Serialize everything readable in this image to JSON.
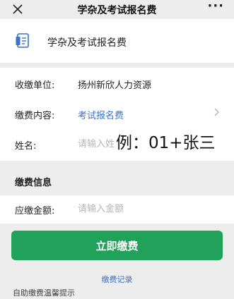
{
  "nav": {
    "title": "学杂及考试报名费",
    "more": "···"
  },
  "header": {
    "title": "学杂及考试报名费"
  },
  "form": {
    "payee_label": "收缴单位:",
    "payee_value": "扬州新欣人力资源",
    "content_label": "缴费内容:",
    "content_value": "考试报名费",
    "name_label": "姓名:",
    "name_placeholder": "请输入姓名"
  },
  "hint_overlay": "例：01+张三",
  "payment": {
    "section_title": "缴费信息",
    "amount_label": "应缴金额:",
    "amount_placeholder": "请输入金额"
  },
  "actions": {
    "pay_button": "立即缴费",
    "records_link": "缴费记录",
    "tips_text": "自助缴费温馨提示"
  },
  "colors": {
    "accent_green": "#20a25a",
    "link_blue": "#3a73c8",
    "background": "#ededed"
  }
}
